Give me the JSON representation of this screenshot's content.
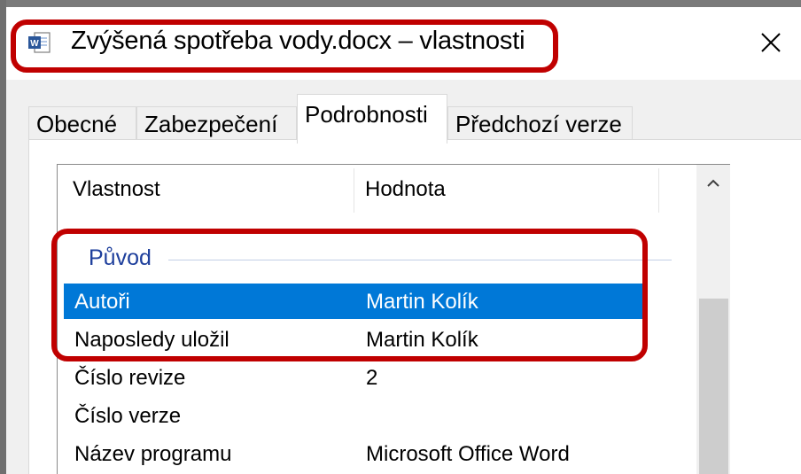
{
  "window": {
    "title": "Zvýšená spotřeba vody.docx – vlastnosti",
    "title_icon": "word-doc-icon",
    "close_icon": "close-icon"
  },
  "tabs": [
    {
      "label": "Obecné",
      "active": false
    },
    {
      "label": "Zabezpečení",
      "active": false
    },
    {
      "label": "Podrobnosti",
      "active": true
    },
    {
      "label": "Předchozí verze",
      "active": false
    }
  ],
  "table": {
    "columns": [
      "Vlastnost",
      "Hodnota"
    ],
    "group": "Původ",
    "rows": [
      {
        "property": "Autoři",
        "value": "Martin Kolík",
        "selected": true
      },
      {
        "property": "Naposledy uložil",
        "value": "Martin Kolík",
        "selected": false
      },
      {
        "property": "Číslo revize",
        "value": "2",
        "selected": false
      },
      {
        "property": "Číslo verze",
        "value": "",
        "selected": false
      },
      {
        "property": "Název programu",
        "value": "Microsoft Office Word",
        "selected": false
      }
    ]
  },
  "colors": {
    "selection": "#0078d7",
    "highlight": "#c00000",
    "group_label": "#1e3f9c"
  }
}
